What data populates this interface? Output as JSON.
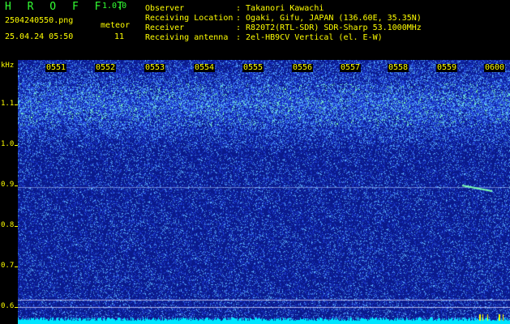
{
  "header": {
    "app_name": "H R O F F T",
    "version": "1.0.0",
    "filename": "2504240550.png",
    "datetime": "25.04.24 05:50",
    "meteor_label": "meteor",
    "meteor_count": "11"
  },
  "station": {
    "observer_label": "Observer",
    "observer_value": ": Takanori Kawachi",
    "location_label": "Receiving Location",
    "location_value": ": Ogaki, Gifu, JAPAN (136.60E, 35.35N)",
    "receiver_label": "Receiver",
    "receiver_value": ": R820T2(RTL-SDR) SDR-Sharp 53.1000MHz",
    "antenna_label": "Receiving antenna",
    "antenna_value": ": 2el-HB9CV Vertical (el. E-W)"
  },
  "spectrogram": {
    "y_unit": "kHz",
    "y_ticks": [
      "1.1",
      "1.0",
      "0.9",
      "0.8",
      "0.7",
      "0.6"
    ],
    "x_ticks": [
      "0551",
      "0552",
      "0553",
      "0554",
      "0555",
      "0556",
      "0557",
      "0558",
      "0559",
      "0600"
    ],
    "colors": {
      "background": "#0a1a8c",
      "noise_dim": "#1f3fd6",
      "noise_bright": "#5ab0ff",
      "signal": "#7dffb0",
      "baseline": "#00e5ff"
    }
  }
}
